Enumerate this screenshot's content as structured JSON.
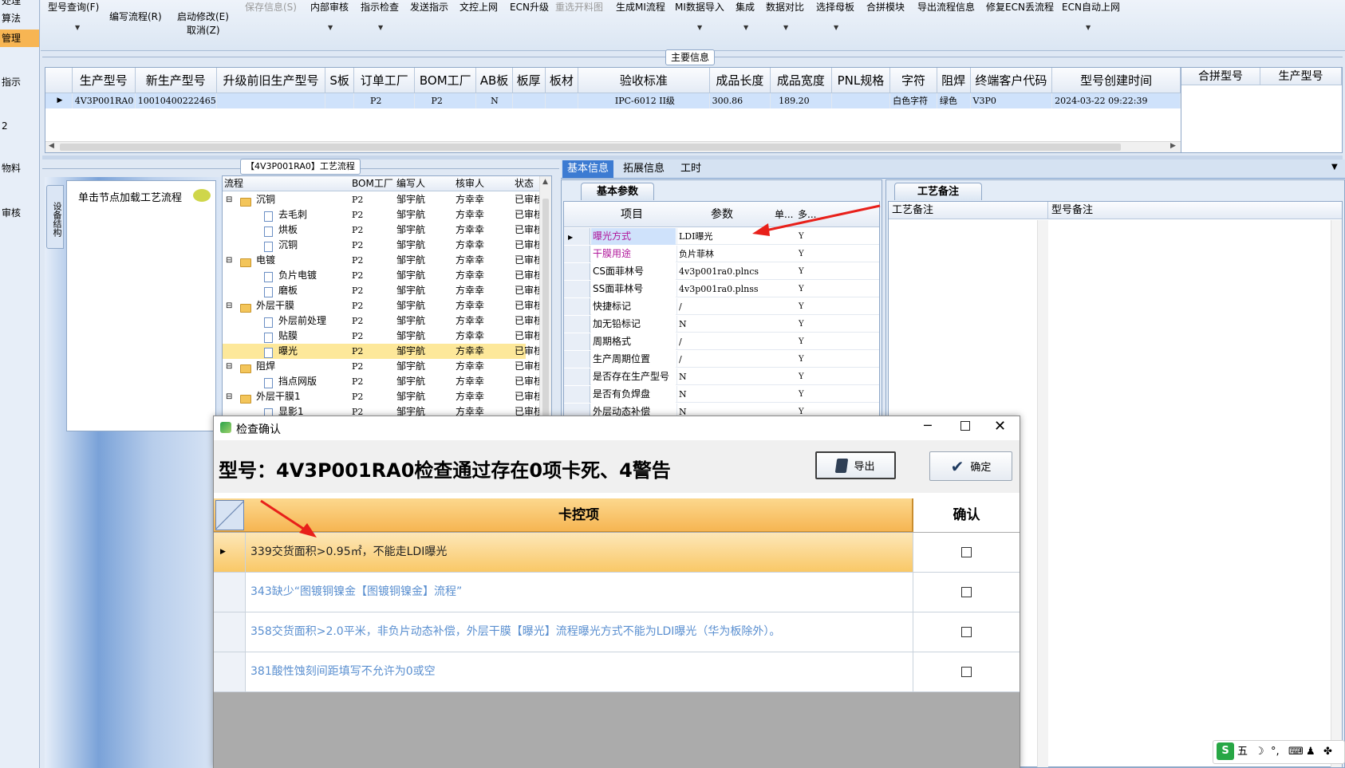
{
  "leftnav": {
    "items": [
      "处理",
      "算法",
      "管理",
      "指示",
      "2",
      "物料",
      "审核"
    ]
  },
  "toolbar": {
    "items": [
      {
        "label": "型号查询(F)",
        "has_arrow": true
      },
      {
        "label": "编写流程(R)",
        "has_arrow": false
      },
      {
        "label": "启动修改(E)",
        "sub": "取消(Z)",
        "has_arrow": false
      },
      {
        "label": "保存信息(S)",
        "disabled": true
      },
      {
        "label": "内部审核",
        "has_arrow": true
      },
      {
        "label": "指示检查",
        "has_arrow": true
      },
      {
        "label": "发送指示"
      },
      {
        "label": "文控上网"
      },
      {
        "label": "ECN升级"
      },
      {
        "label": "重选开料图",
        "disabled": true
      },
      {
        "label": "生成MI流程"
      },
      {
        "label": "MI数据导入",
        "has_arrow": true
      },
      {
        "label": "集成",
        "has_arrow": true
      },
      {
        "label": "数据对比",
        "has_arrow": true
      },
      {
        "label": "选择母板",
        "has_arrow": true
      },
      {
        "label": "合拼模块"
      },
      {
        "label": "导出流程信息"
      },
      {
        "label": "修复ECN丢流程"
      },
      {
        "label": "ECN自动上网",
        "has_arrow": true
      }
    ]
  },
  "main_info": {
    "title": "主要信息",
    "columns": [
      "生产型号",
      "新生产型号",
      "升级前旧生产型号",
      "S板",
      "订单工厂",
      "BOM工厂",
      "AB板",
      "板厚",
      "板材",
      "验收标准",
      "成品长度",
      "成品宽度",
      "PNL规格",
      "字符",
      "阻焊",
      "终端客户代码",
      "型号创建时间"
    ],
    "row": [
      "4V3P001RA0",
      "10010400222465",
      "",
      "",
      "P2",
      "P2",
      "N",
      "",
      "",
      "IPC-6012 II级",
      "300.86",
      "189.20",
      "",
      "白色字符",
      "绿色",
      "V3P0",
      "2024-03-22 09:22:39"
    ],
    "side_columns": [
      "合拼型号",
      "生产型号"
    ]
  },
  "process": {
    "title": "【4V3P001RA0】工艺流程",
    "vertical_tab": "设备结构",
    "hint": "单击节点加载工艺流程",
    "columns": [
      "流程",
      "BOM工厂",
      "编写人",
      "核审人",
      "状态"
    ],
    "rows": [
      {
        "name": "沉铜",
        "type": "folder",
        "level": 0,
        "bom": "P2",
        "writer": "邹宇航",
        "reviewer": "方幸幸",
        "status": "已审核"
      },
      {
        "name": "去毛刺",
        "type": "doc",
        "level": 1,
        "bom": "P2",
        "writer": "邹宇航",
        "reviewer": "方幸幸",
        "status": "已审核"
      },
      {
        "name": "烘板",
        "type": "doc",
        "level": 1,
        "bom": "P2",
        "writer": "邹宇航",
        "reviewer": "方幸幸",
        "status": "已审核"
      },
      {
        "name": "沉铜",
        "type": "doc",
        "level": 1,
        "bom": "P2",
        "writer": "邹宇航",
        "reviewer": "方幸幸",
        "status": "已审核"
      },
      {
        "name": "电镀",
        "type": "folder",
        "level": 0,
        "bom": "P2",
        "writer": "邹宇航",
        "reviewer": "方幸幸",
        "status": "已审核"
      },
      {
        "name": "负片电镀",
        "type": "doc",
        "level": 1,
        "bom": "P2",
        "writer": "邹宇航",
        "reviewer": "方幸幸",
        "status": "已审核"
      },
      {
        "name": "磨板",
        "type": "doc",
        "level": 1,
        "bom": "P2",
        "writer": "邹宇航",
        "reviewer": "方幸幸",
        "status": "已审核"
      },
      {
        "name": "外层干膜",
        "type": "folder",
        "level": 0,
        "bom": "P2",
        "writer": "邹宇航",
        "reviewer": "方幸幸",
        "status": "已审核"
      },
      {
        "name": "外层前处理",
        "type": "doc",
        "level": 1,
        "bom": "P2",
        "writer": "邹宇航",
        "reviewer": "方幸幸",
        "status": "已审核"
      },
      {
        "name": "贴膜",
        "type": "doc",
        "level": 1,
        "bom": "P2",
        "writer": "邹宇航",
        "reviewer": "方幸幸",
        "status": "已审核"
      },
      {
        "name": "曝光",
        "type": "doc",
        "level": 1,
        "bom": "P2",
        "writer": "邹宇航",
        "reviewer": "方幸幸",
        "status": "已审核",
        "selected": true
      },
      {
        "name": "阻焊",
        "type": "folder",
        "level": 0,
        "bom": "P2",
        "writer": "邹宇航",
        "reviewer": "方幸幸",
        "status": "已审核"
      },
      {
        "name": "挡点网版",
        "type": "doc",
        "level": 1,
        "bom": "P2",
        "writer": "邹宇航",
        "reviewer": "方幸幸",
        "status": "已审核"
      },
      {
        "name": "外层干膜1",
        "type": "folder",
        "level": 0,
        "bom": "P2",
        "writer": "邹宇航",
        "reviewer": "方幸幸",
        "status": "已审核"
      },
      {
        "name": "显影1",
        "type": "doc",
        "level": 1,
        "bom": "P2",
        "writer": "邹宇航",
        "reviewer": "方幸幸",
        "status": "已审核"
      }
    ]
  },
  "info_tabs": [
    "基本信息",
    "拓展信息",
    "工时"
  ],
  "basic_params": {
    "tab": "基本参数",
    "columns": [
      "项目",
      "参数",
      "单...",
      "多..."
    ],
    "rows": [
      {
        "item": "曝光方式",
        "value": "LDI曝光",
        "flag": "Y",
        "highlight": true
      },
      {
        "item": "干膜用途",
        "value": "负片菲林",
        "flag": "Y",
        "magenta": true
      },
      {
        "item": "CS面菲林号",
        "value": "4v3p001ra0.plncs",
        "flag": "Y"
      },
      {
        "item": "SS面菲林号",
        "value": "4v3p001ra0.plnss",
        "flag": "Y"
      },
      {
        "item": "快捷标记",
        "value": "/",
        "flag": "Y"
      },
      {
        "item": "加无铅标记",
        "value": "N",
        "flag": "Y"
      },
      {
        "item": "周期格式",
        "value": "/",
        "flag": "Y"
      },
      {
        "item": "生产周期位置",
        "value": "/",
        "flag": "Y"
      },
      {
        "item": "是否存在生产型号",
        "value": "N",
        "flag": "Y"
      },
      {
        "item": "是否有负焊盘",
        "value": "N",
        "flag": "Y"
      },
      {
        "item": "外层动态补偿",
        "value": "N",
        "flag": "Y"
      }
    ]
  },
  "remarks": {
    "tab": "工艺备注",
    "col1": "工艺备注",
    "col2": "型号备注"
  },
  "dialog": {
    "title": "检查确认",
    "heading": "型号：4V3P001RA0检查通过存在0项卡死、4警告",
    "export_label": "导出",
    "ok_label": "确定",
    "col_item": "卡控项",
    "col_confirm": "确认",
    "rows": [
      {
        "text": "339交货面积>0.95㎡，不能走LDI曝光",
        "selected": true
      },
      {
        "text": "343缺少“图镀铜镍金【图镀铜镍金】流程”"
      },
      {
        "text": "358交货面积>2.0平米，非负片动态补偿，外层干膜【曝光】流程曝光方式不能为LDI曝光（华为板除外）。"
      },
      {
        "text": "381酸性蚀刻间距填写不允许为0或空"
      }
    ]
  },
  "ime": {
    "label": "五"
  },
  "colors": {
    "selected_row": "#cfe2fb",
    "accent_orange": "#f7b553",
    "warning_text": "#5a8fd0",
    "arrow": "#e8201a"
  }
}
